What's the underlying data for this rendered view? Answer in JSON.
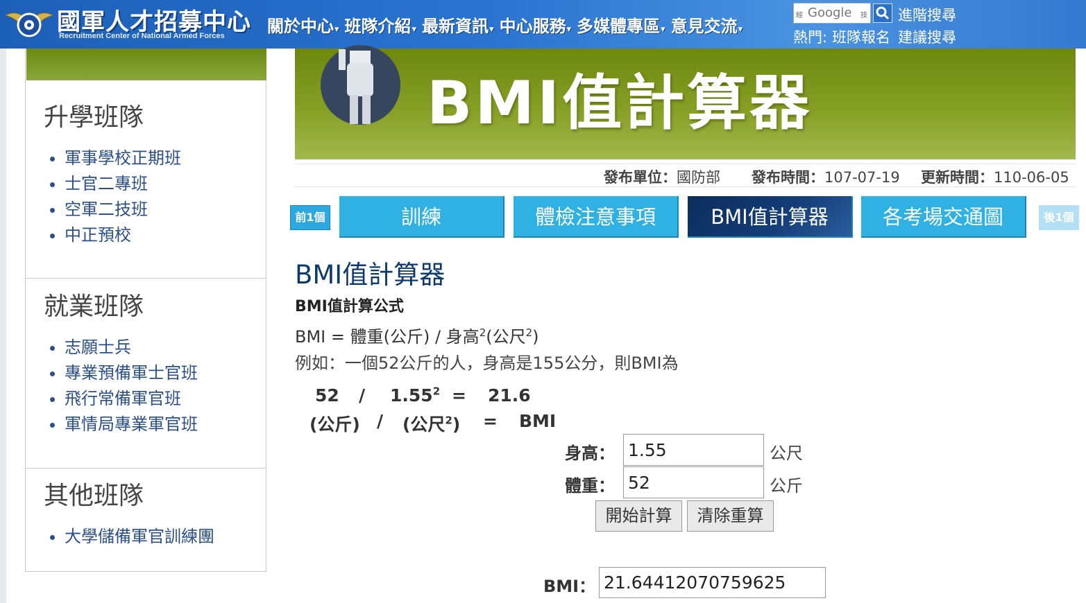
{
  "header": {
    "title": "國軍人才招募中心",
    "subtitle": "Recruitment Center of National Armed Forces",
    "nav": [
      "關於中心",
      "班隊介紹",
      "最新資訊",
      "中心服務",
      "多媒體專區",
      "意見交流"
    ],
    "search_brand": "Google",
    "search_left_tag": "經",
    "search_right_tag": "技",
    "advanced_search": "進階搜尋",
    "hot_label": "熱門:",
    "hot_links": [
      "班隊報名",
      "建議搜尋"
    ]
  },
  "sidebar": {
    "sections": [
      {
        "title": "升學班隊",
        "items": [
          "軍事學校正期班",
          "士官二專班",
          "空軍二技班",
          "中正預校"
        ]
      },
      {
        "title": "就業班隊",
        "items": [
          "志願士兵",
          "專業預備軍士官班",
          "飛行常備軍官班",
          "軍情局專業軍官班"
        ]
      },
      {
        "title": "其他班隊",
        "items": [
          "大學儲備軍官訓練團"
        ]
      }
    ]
  },
  "banner": {
    "title": "BMI值計算器"
  },
  "meta": {
    "publisher_label": "發布單位：",
    "publisher": "國防部",
    "published_label": "發布時間：",
    "published": "107-07-19",
    "updated_label": "更新時間：",
    "updated": "110-06-05"
  },
  "tabs": {
    "prev": "前1個",
    "next": "後1個",
    "items": [
      "訓練",
      "體檢注意事項",
      "BMI值計算器",
      "各考場交通圖"
    ],
    "active_index": 2
  },
  "content": {
    "heading": "BMI值計算器",
    "subheading": "BMI值計算公式",
    "formula_prefix": "BMI = 體重(公斤) / 身高",
    "formula_sup1": "2",
    "formula_mid": "(公尺",
    "formula_sup2": "2",
    "formula_suffix": ")",
    "example": "例如：一個52公斤的人，身高是155公分，則BMI為",
    "calc": {
      "weight": "52",
      "slash": "/",
      "height": "1.55",
      "sup": "2",
      "eq": "=",
      "result": "21.6",
      "unit_weight": "(公斤)",
      "unit_height_pre": "(公尺",
      "unit_height_sup": "2",
      "unit_height_post": ")",
      "unit_result": "BMI"
    }
  },
  "form": {
    "height_label": "身高：",
    "height_value": "1.55",
    "height_unit": "公尺",
    "weight_label": "體重：",
    "weight_value": "52",
    "weight_unit": "公斤",
    "calculate_button": "開始計算",
    "clear_button": "清除重算",
    "bmi_label": "BMI：",
    "bmi_value": "21.64412070759625"
  }
}
